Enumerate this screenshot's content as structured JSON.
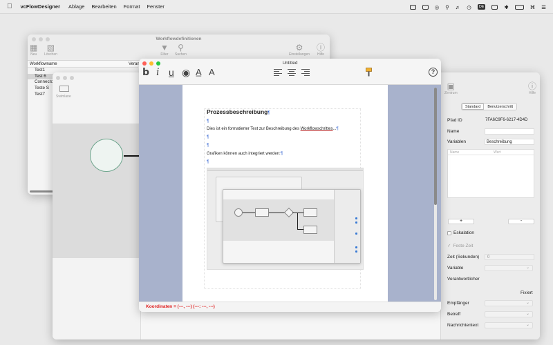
{
  "menubar": {
    "app_name": "vcFlowDesigner",
    "items": [
      "Ablage",
      "Bearbeiten",
      "Format",
      "Fenster"
    ],
    "status_badges": [
      "DE"
    ]
  },
  "workflow_window": {
    "title": "Workflowdefinitionen",
    "toolbar": {
      "new_label": "Neu",
      "delete_label": "Löschen",
      "filter_label": "Filter",
      "search_label": "Suchen",
      "settings_label": "Einstellungen",
      "help_label": "Hilfe"
    },
    "columns": [
      "Workflowname",
      "Verant"
    ],
    "rows": [
      "Test1",
      "Test 6",
      "Connector",
      "Teste S",
      "Test7"
    ],
    "selected_row": "Test 6"
  },
  "designer_window": {
    "swimlane_label": "Swimlane",
    "center_label": "Zentrum",
    "help_label": "Hilfe",
    "tabs": [
      "Standard",
      "Benutzerschritt"
    ],
    "active_tab": "Standard",
    "properties": {
      "pfad_id_label": "Pfad ID",
      "pfad_id_value": "7FA6C9F6-6217-4D4D",
      "name_label": "Name",
      "name_value": "",
      "variablen_label": "Variablen",
      "variablen_value": "Beschreibung",
      "var_table_headers": [
        "Name",
        "Wert"
      ],
      "add_symbol": "+",
      "remove_symbol": "-",
      "eskalation_label": "Eskalation",
      "feste_zeit_label": "Feste Zeit",
      "zeit_label": "Zeit (Sekunden)",
      "zeit_value": "0",
      "variable_label": "Variable",
      "verantwortlicher_label": "Verantwortlicher",
      "fixiert_label": "Fixiert",
      "empfaenger_label": "Empfänger",
      "betreff_label": "Betreff",
      "nachrichtentext_label": "Nachrichtentext"
    }
  },
  "editor_window": {
    "title": "Untitled",
    "format_buttons": [
      "b",
      "i",
      "u"
    ],
    "doc": {
      "heading": "Prozessbeschreibung",
      "line1_prefix": "Dies ist ein formatierter Text zur Beschreibung des ",
      "line1_link": "Workflowschrittes",
      "line1_suffix": "...",
      "line2": "Grafiken können auch integriert werden:",
      "pilcrow": "¶"
    },
    "coords": "Koordinaten = (---, ---) (---: ---, ---)"
  },
  "colors": {
    "accent_red": "#e02020",
    "page_background": "#a8b2cc",
    "start_node_border": "#6ea58d"
  }
}
